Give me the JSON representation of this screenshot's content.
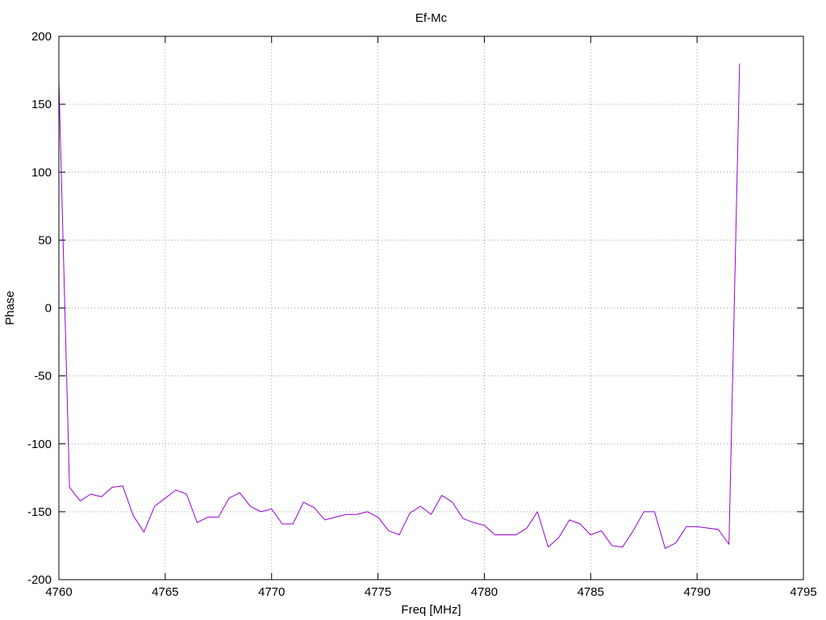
{
  "chart_data": {
    "type": "line",
    "title": "Ef-Mc",
    "xlabel": "Freq [MHz]",
    "ylabel": "Phase",
    "xlim": [
      4760,
      4795
    ],
    "ylim": [
      -200,
      200
    ],
    "xticks": [
      4760,
      4765,
      4770,
      4775,
      4780,
      4785,
      4790,
      4795
    ],
    "yticks": [
      -200,
      -150,
      -100,
      -50,
      0,
      50,
      100,
      150,
      200
    ],
    "grid": true,
    "line_color": "#9400d3",
    "series": [
      {
        "x": [
          4760.0,
          4760.5,
          4761.0,
          4761.5,
          4762.0,
          4762.5,
          4763.0,
          4763.5,
          4764.0,
          4764.5,
          4765.0,
          4765.5,
          4766.0,
          4766.5,
          4767.0,
          4767.5,
          4768.0,
          4768.5,
          4769.0,
          4769.5,
          4770.0,
          4770.5,
          4771.0,
          4771.5,
          4772.0,
          4772.5,
          4773.0,
          4773.5,
          4774.0,
          4774.5,
          4775.0,
          4775.5,
          4776.0,
          4776.5,
          4777.0,
          4777.5,
          4778.0,
          4778.5,
          4779.0,
          4779.5,
          4780.0,
          4780.5,
          4781.0,
          4781.5,
          4782.0,
          4782.5,
          4783.0,
          4783.5,
          4784.0,
          4784.5,
          4785.0,
          4785.5,
          4786.0,
          4786.5,
          4787.0,
          4787.5,
          4788.0,
          4788.5,
          4789.0,
          4789.5,
          4790.0,
          4790.5,
          4791.0,
          4791.5,
          4792.0
        ],
        "y": [
          167,
          -132,
          -142,
          -137,
          -139,
          -132,
          -131,
          -153,
          -165,
          -146,
          -140,
          -134,
          -137,
          -158,
          -154,
          -154,
          -140,
          -136,
          -146,
          -150,
          -148,
          -159,
          -159,
          -143,
          -147,
          -156,
          -154,
          -152,
          -152,
          -150,
          -154,
          -164,
          -167,
          -151,
          -146,
          -152,
          -138,
          -143,
          -155,
          -158,
          -160,
          -167,
          -167,
          -167,
          -162,
          -150,
          -176,
          -169,
          -156,
          -159,
          -167,
          -164,
          -175,
          -176,
          -164,
          -150,
          -150,
          -177,
          -173,
          -161,
          -161,
          -162,
          -163,
          -174,
          180
        ]
      }
    ]
  }
}
